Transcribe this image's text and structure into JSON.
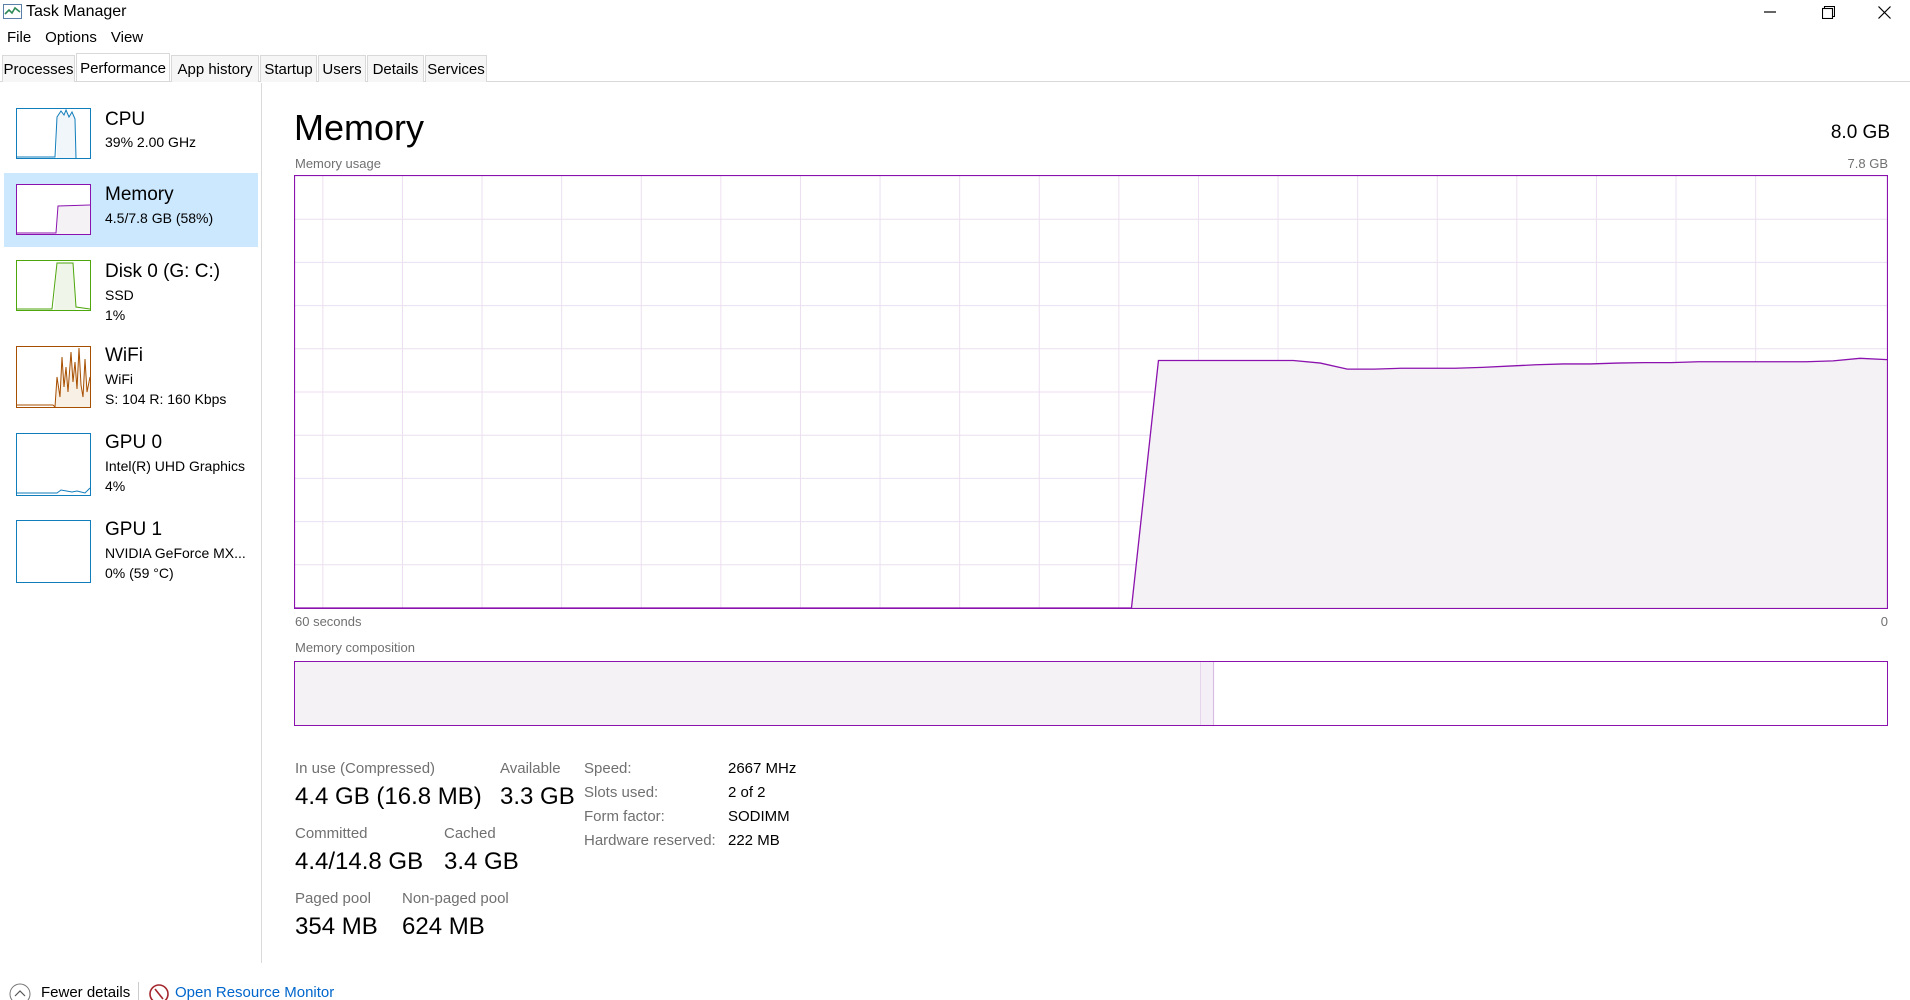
{
  "window": {
    "title": "Task Manager",
    "controls": [
      "minimize",
      "maximize",
      "close"
    ]
  },
  "menu": [
    "File",
    "Options",
    "View"
  ],
  "tabs": [
    {
      "label": "Processes",
      "active": false
    },
    {
      "label": "Performance",
      "active": true
    },
    {
      "label": "App history",
      "active": false
    },
    {
      "label": "Startup",
      "active": false
    },
    {
      "label": "Users",
      "active": false
    },
    {
      "label": "Details",
      "active": false
    },
    {
      "label": "Services",
      "active": false
    }
  ],
  "sidebar": [
    {
      "name": "CPU",
      "lines": [
        "39%  2.00 GHz"
      ],
      "color": "#117dbb",
      "selected": false
    },
    {
      "name": "Memory",
      "lines": [
        "4.5/7.8 GB (58%)"
      ],
      "color": "#8b12ae",
      "selected": true
    },
    {
      "name": "Disk 0 (G: C:)",
      "lines": [
        "SSD",
        "1%"
      ],
      "color": "#4da60c",
      "selected": false
    },
    {
      "name": "WiFi",
      "lines": [
        "WiFi",
        "S: 104  R: 160 Kbps"
      ],
      "color": "#a74f01",
      "selected": false
    },
    {
      "name": "GPU 0",
      "lines": [
        "Intel(R) UHD Graphics",
        "4%"
      ],
      "color": "#117dbb",
      "selected": false
    },
    {
      "name": "GPU 1",
      "lines": [
        "NVIDIA GeForce MX...",
        "0%  (59 °C)"
      ],
      "color": "#117dbb",
      "selected": false
    }
  ],
  "memory": {
    "title": "Memory",
    "total": "8.0 GB",
    "usage_label": "Memory usage",
    "usage_max": "7.8 GB",
    "time_left": "60 seconds",
    "time_right": "0",
    "composition_label": "Memory composition",
    "composition": {
      "in_use_fraction": 0.569,
      "modified_fraction": 0.008
    },
    "usage_history_fraction": [
      0,
      0,
      0,
      0,
      0,
      0,
      0,
      0,
      0,
      0,
      0,
      0,
      0,
      0,
      0,
      0,
      0,
      0,
      0,
      0,
      0,
      0,
      0,
      0,
      0,
      0,
      0,
      0,
      0,
      0,
      0,
      0,
      0.573,
      0.573,
      0.573,
      0.573,
      0.573,
      0.573,
      0.567,
      0.553,
      0.553,
      0.555,
      0.555,
      0.555,
      0.557,
      0.56,
      0.563,
      0.565,
      0.565,
      0.567,
      0.568,
      0.568,
      0.57,
      0.57,
      0.57,
      0.57,
      0.57,
      0.572,
      0.578,
      0.575
    ],
    "stats": {
      "in_use_label": "In use (Compressed)",
      "in_use_value": "4.4 GB (16.8 MB)",
      "available_label": "Available",
      "available_value": "3.3 GB",
      "committed_label": "Committed",
      "committed_value": "4.4/14.8 GB",
      "cached_label": "Cached",
      "cached_value": "3.4 GB",
      "paged_label": "Paged pool",
      "paged_value": "354 MB",
      "nonpaged_label": "Non-paged pool",
      "nonpaged_value": "624 MB"
    },
    "specs": {
      "speed_label": "Speed:",
      "speed_value": "2667 MHz",
      "slots_label": "Slots used:",
      "slots_value": "2 of 2",
      "form_label": "Form factor:",
      "form_value": "SODIMM",
      "reserved_label": "Hardware reserved:",
      "reserved_value": "222 MB"
    }
  },
  "footer": {
    "fewer_details": "Fewer details",
    "open_monitor": "Open Resource Monitor"
  }
}
